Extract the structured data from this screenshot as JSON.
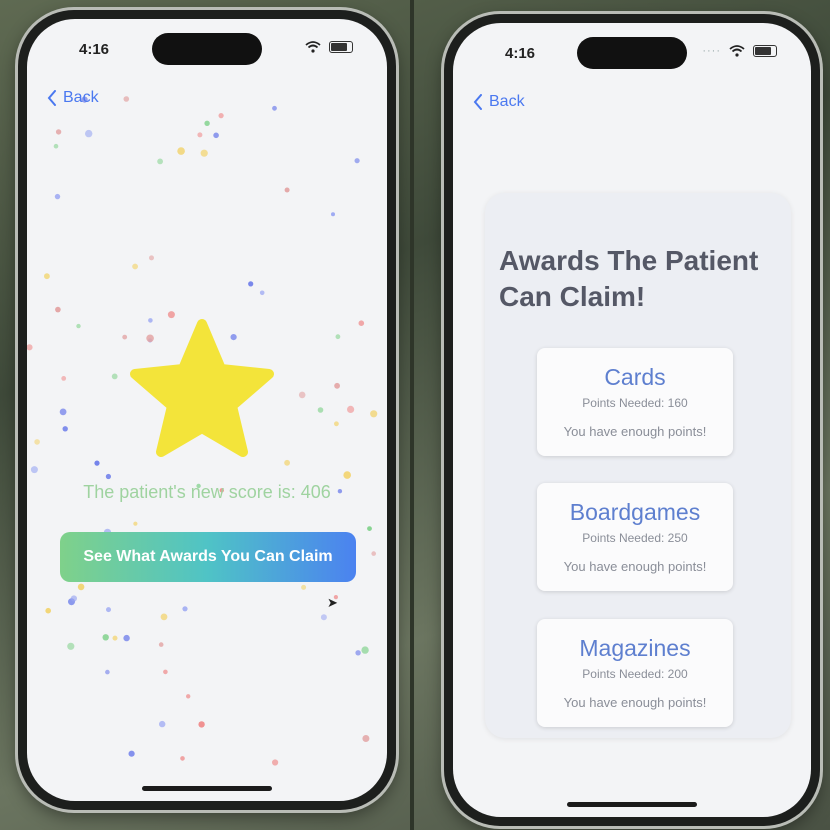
{
  "left_screen": {
    "status_time": "4:16",
    "back_label": "Back",
    "score_text": "The patient's new score is: 406",
    "claim_button_label": "See What Awards You Can Claim"
  },
  "right_screen": {
    "status_time": "4:16",
    "back_label": "Back",
    "title": "Awards The Patient Can Claim!",
    "awards": [
      {
        "name": "Cards",
        "points": "Points Needed: 160",
        "status": "You have enough points!"
      },
      {
        "name": "Boardgames",
        "points": "Points Needed: 250",
        "status": "You have enough points!"
      },
      {
        "name": "Magazines",
        "points": "Points Needed: 200",
        "status": "You have enough points!"
      }
    ]
  },
  "icons": {
    "back": "chevron-left-icon",
    "wifi": "wifi-icon",
    "battery": "battery-icon",
    "star": "star-icon",
    "cursor": "cursor-icon"
  },
  "colors": {
    "accent_blue": "#4a78f0",
    "star_yellow": "#f3e43a",
    "score_green": "#9fd3a0",
    "award_name_blue": "#5e7fcf",
    "button_gradient": [
      "#7fd18a",
      "#4fc3c6",
      "#4b82f0"
    ]
  }
}
